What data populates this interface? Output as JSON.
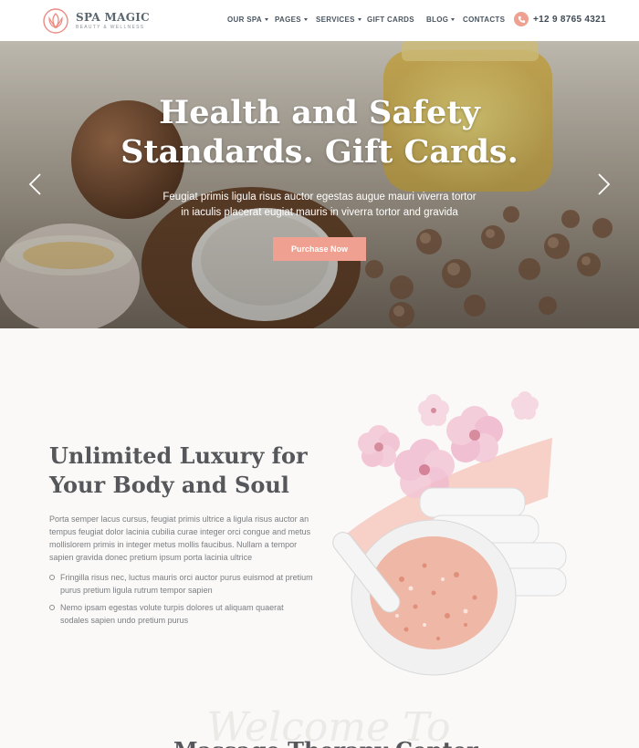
{
  "brand": {
    "name": "SPA MAGIC",
    "tagline": "BEAUTY & WELLNESS"
  },
  "nav": {
    "items": [
      {
        "label": "OUR SPA",
        "has_dropdown": true
      },
      {
        "label": "PAGES",
        "has_dropdown": true
      },
      {
        "label": "SERVICES",
        "has_dropdown": true
      },
      {
        "label": "GIFT CARDS",
        "has_dropdown": false
      },
      {
        "label": "BLOG",
        "has_dropdown": true
      },
      {
        "label": "CONTACTS",
        "has_dropdown": false
      }
    ],
    "phone": "+12 9 8765 4321",
    "phone_icon": "phone-icon"
  },
  "hero": {
    "title_line1": "Health and Safety",
    "title_line2": "Standards. Gift Cards.",
    "subtitle_line1": "Feugiat primis ligula risus auctor egestas augue mauri viverra tortor",
    "subtitle_line2": "in iaculis placerat eugiat mauris in viverra tortor and gravida",
    "button": "Purchase Now",
    "prev_icon": "chevron-left-icon",
    "next_icon": "chevron-right-icon"
  },
  "about": {
    "title_line1": "Unlimited Luxury for",
    "title_line2": "Your Body and Soul",
    "body": "Porta semper lacus cursus, feugiat primis ultrice a ligula risus auctor an tempus feugiat dolor lacinia cubilia curae integer orci congue and metus mollislorem primis in integer metus mollis faucibus. Nullam a tempor sapien gravida donec pretium ipsum porta lacinia ultrice",
    "bullets": [
      "Fringilla risus nec, luctus mauris orci auctor purus euismod at pretium purus pretium ligula rutrum tempor sapien",
      "Nemo ipsam egestas volute turpis dolores ut aliquam quaerat sodales sapien undo pretium purus"
    ]
  },
  "welcome": {
    "script": "Welcome To",
    "title": "Massage Therapy Center"
  },
  "colors": {
    "accent": "#f0a090",
    "heading": "#55575a",
    "body_text": "#7a7d80",
    "nav_text": "#4a5560",
    "page_bg": "#faf9f8"
  }
}
